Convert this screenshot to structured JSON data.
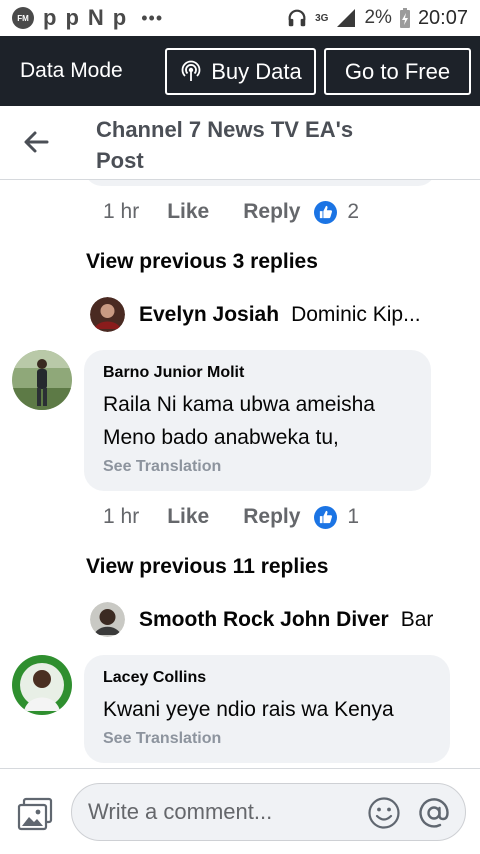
{
  "status_bar": {
    "network_type": "3G",
    "battery": "2%",
    "time": "20:07"
  },
  "data_bar": {
    "mode_label": "Data Mode",
    "buy_data_label": "Buy Data",
    "go_free_label": "Go to Free"
  },
  "header": {
    "title": "Channel 7 News TV EA's Post"
  },
  "thread_1": {
    "meta": {
      "time": "1 hr",
      "like": "Like",
      "reply": "Reply",
      "reactions": "2"
    },
    "view_previous": "View previous 3 replies",
    "reply_preview": {
      "name": "Evelyn Josiah",
      "text": "Dominic Kip..."
    }
  },
  "comment_1": {
    "author": "Barno Junior Molit",
    "text_line1": "Raila Ni kama ubwa ameisha",
    "text_line2": "Meno bado anabweka tu,",
    "translate": "See Translation",
    "meta": {
      "time": "1 hr",
      "like": "Like",
      "reply": "Reply",
      "reactions": "1"
    },
    "view_previous": "View previous 11 replies",
    "reply_preview": {
      "name": "Smooth Rock John Diver",
      "text": "Bar"
    }
  },
  "comment_2": {
    "author": "Lacey Collins",
    "text": "Kwani yeye ndio rais wa Kenya",
    "translate": "See Translation"
  },
  "composer": {
    "placeholder": "Write a comment..."
  },
  "colors": {
    "data_bar_bg": "#1d2229",
    "bubble_bg": "#f0f2f5",
    "like_blue": "#1b74e4"
  }
}
